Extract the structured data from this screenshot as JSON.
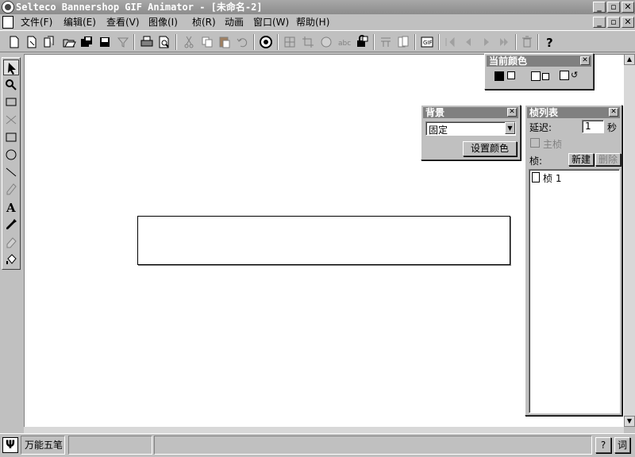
{
  "window": {
    "title": "Selteco Bannershop GIF Animator - [未命名-2]",
    "controls": {
      "minimize": "_",
      "restore": "🗗",
      "close": "✕"
    }
  },
  "menu": {
    "items": [
      {
        "label": "文件(F)"
      },
      {
        "label": "编辑(E)"
      },
      {
        "label": "查看(V)"
      },
      {
        "label": "图像(I)"
      },
      {
        "label": "桢(R)"
      },
      {
        "label": "动画"
      },
      {
        "label": "窗口(W)"
      },
      {
        "label": "帮助(H)"
      }
    ]
  },
  "toolbar": {
    "icons": [
      "new-icon",
      "new-from-image-icon",
      "copy-doc-icon",
      "open-icon",
      "save-all-icon",
      "save-icon",
      "filter-icon",
      "print-icon",
      "print-preview-icon",
      "cut-icon",
      "copy-icon",
      "paste-icon",
      "undo-icon",
      "preview-animation-icon",
      "resize-icon",
      "crop-icon",
      "effects-icon",
      "text-icon",
      "lock-icon",
      "split-icon",
      "frame-icon",
      "optimize-icon",
      "first-frame-icon",
      "prev-frame-icon",
      "next-frame-icon",
      "last-frame-icon",
      "delete-frame-icon",
      "help-icon"
    ]
  },
  "tools": [
    "select-arrow-icon",
    "zoom-icon",
    "frame-rect-icon",
    "scissors-icon",
    "rectangle-icon",
    "ellipse-icon",
    "line-icon",
    "pencil-icon",
    "text-tool-icon",
    "eyedropper-icon",
    "eraser-icon",
    "fill-bucket-icon"
  ],
  "current_color_panel": {
    "title": "当前颜色",
    "foreground": "#000000",
    "background": "#ffffff"
  },
  "background_panel": {
    "title": "背景",
    "mode_value": "固定",
    "set_color_button": "设置颜色"
  },
  "frame_list_panel": {
    "title": "桢列表",
    "delay_label": "延迟:",
    "delay_value": "1",
    "delay_unit": "秒",
    "main_frame_label": "主桢",
    "frames_label": "桢:",
    "new_button": "新建",
    "delete_button": "删除",
    "frames": [
      {
        "label": "桢 1"
      }
    ]
  },
  "statusbar": {
    "ime_label": "万能五笔",
    "help_button": "?",
    "word_button": "词"
  }
}
